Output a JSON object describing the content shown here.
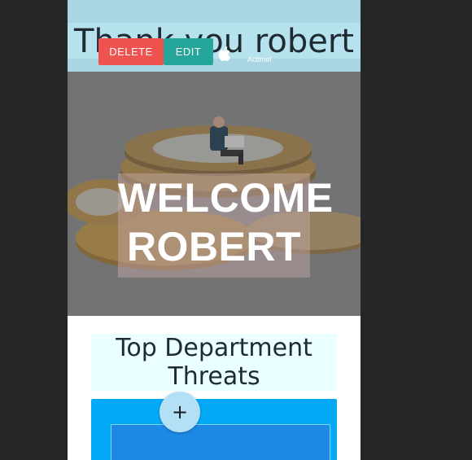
{
  "header": {
    "greeting": "Thank you robert"
  },
  "hero": {
    "line1": "WELCOME",
    "line2": "ROBERT"
  },
  "section": {
    "title": "Top Department Threats"
  },
  "card": {
    "delete_label": "DELETE",
    "edit_label": "EDIT",
    "item_icon": "apple-icon",
    "item_name": "Actimel"
  },
  "fab": {
    "label": "+"
  },
  "colors": {
    "page_bg": "#262626",
    "header_bg": "#b5e2ec",
    "card_bg": "#03a9f4",
    "delete": "#ef5350",
    "edit": "#26a69a"
  }
}
